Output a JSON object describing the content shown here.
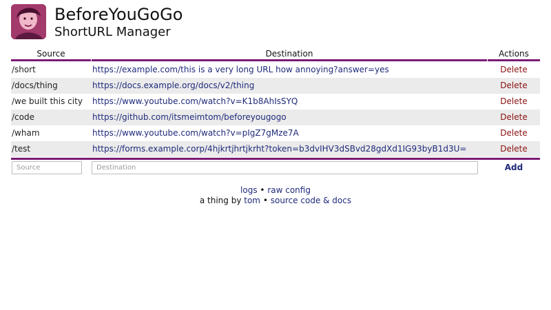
{
  "app": {
    "title": "BeforeYouGoGo",
    "subtitle": "ShortURL Manager"
  },
  "table": {
    "headers": {
      "source": "Source",
      "destination": "Destination",
      "actions": "Actions"
    },
    "rows": [
      {
        "source": "/short",
        "destination": "https://example.com/this is a very long URL how annoying?answer=yes",
        "action": "Delete"
      },
      {
        "source": "/docs/thing",
        "destination": "https://docs.example.org/docs/v2/thing",
        "action": "Delete"
      },
      {
        "source": "/we built this city",
        "destination": "https://www.youtube.com/watch?v=K1b8AhIsSYQ",
        "action": "Delete"
      },
      {
        "source": "/code",
        "destination": "https://github.com/itsmeimtom/beforeyougogo",
        "action": "Delete"
      },
      {
        "source": "/wham",
        "destination": "https://www.youtube.com/watch?v=pIgZ7gMze7A",
        "action": "Delete"
      },
      {
        "source": "/test",
        "destination": "https://forms.example.corp/4hjkrtjhrtjkrht?token=b3dvIHV3dSBvd28gdXd1IG93byB1d3U=",
        "action": "Delete"
      }
    ]
  },
  "add_form": {
    "source_placeholder": "Source",
    "destination_placeholder": "Destination",
    "add_label": "Add"
  },
  "footer": {
    "logs_label": "logs",
    "sep1": " • ",
    "raw_config_label": "raw config",
    "byline_prefix": "a thing by ",
    "author_label": "tom",
    "sep2": " • ",
    "source_docs_label": "source code & docs"
  },
  "colors": {
    "accent": "#7b1a74",
    "link": "#1f2a7a",
    "delete": "#8b1010",
    "row_alt": "#ebebeb"
  }
}
